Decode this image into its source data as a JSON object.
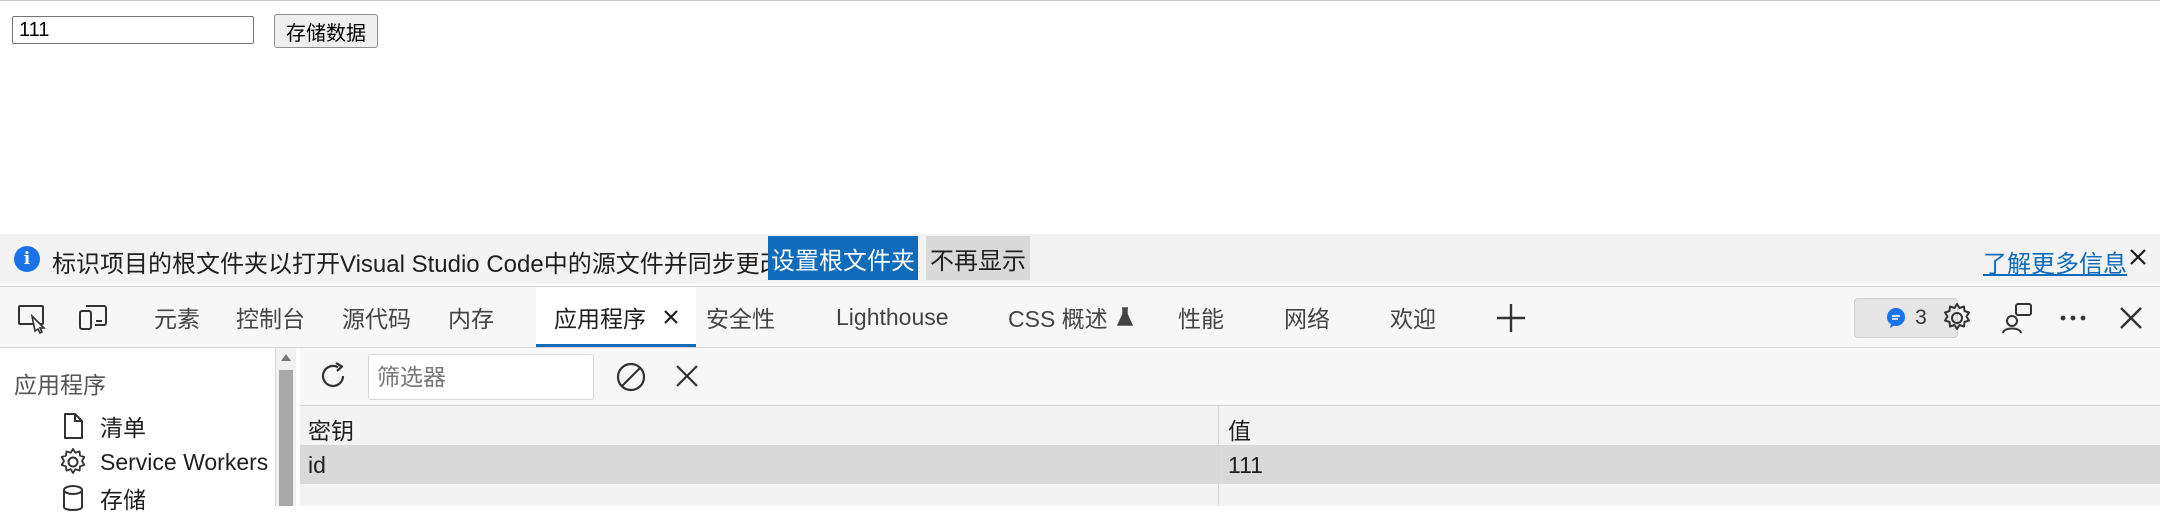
{
  "page": {
    "input_value": "111",
    "button_label": "存储数据"
  },
  "infobar": {
    "message": "标识项目的根文件夹以打开Visual Studio Code中的源文件并同步更改。",
    "primary_button": "设置根文件夹",
    "secondary_button": "不再显示",
    "link": "了解更多信息"
  },
  "toolbar": {
    "tabs": [
      {
        "label": "元素"
      },
      {
        "label": "控制台"
      },
      {
        "label": "源代码"
      },
      {
        "label": "内存"
      },
      {
        "label": "应用程序",
        "active": true
      },
      {
        "label": "安全性"
      },
      {
        "label": "Lighthouse"
      },
      {
        "label": "CSS 概述"
      },
      {
        "label": "性能"
      },
      {
        "label": "网络"
      },
      {
        "label": "欢迎"
      }
    ],
    "issues_count": "3"
  },
  "sidebar": {
    "header": "应用程序",
    "items": [
      {
        "label": "清单",
        "icon": "document-icon"
      },
      {
        "label": "Service Workers",
        "icon": "gear-icon"
      },
      {
        "label": "存储",
        "icon": "database-icon"
      }
    ]
  },
  "storage": {
    "filter_placeholder": "筛选器",
    "columns": [
      "密钥",
      "值"
    ],
    "rows": [
      {
        "key": "id",
        "value": "111"
      }
    ]
  },
  "colors": {
    "accent": "#0f6cbd",
    "info_icon": "#1a73e8"
  }
}
